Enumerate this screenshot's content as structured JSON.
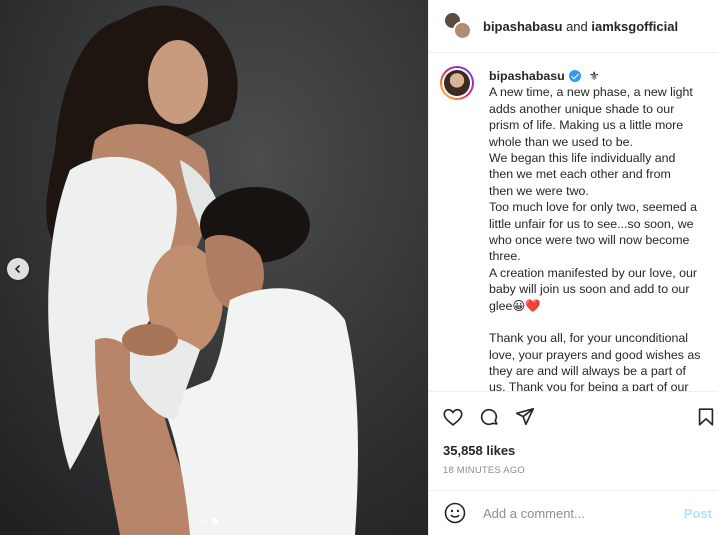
{
  "header": {
    "user1": "bipashabasu",
    "connector": " and ",
    "user2": "iamksgofficial"
  },
  "caption": {
    "username": "bipashabasu",
    "lines": [
      "A new time, a new phase, a new light",
      "adds another unique shade to our",
      "prism of life. Making us a little more",
      "whole than we used to be.",
      "We began this life individually and",
      "then we met each other and from",
      "then we were two.",
      "Too much love for only two, seemed a",
      "little unfair for us to see...so soon, we",
      "who once were two will now become",
      "three.",
      "A creation manifested by our love, our",
      "baby will join us soon and add to our",
      "glee😀❤️",
      "",
      "Thank you all, for your unconditional",
      "love, your prayers and good wishes as",
      "they are and will always be a part of",
      "us. Thank you for being a part of our"
    ]
  },
  "likes": "35,858 likes",
  "time": "18 MINUTES AGO",
  "comment": {
    "placeholder": "Add a comment...",
    "post_label": "Post"
  },
  "icons": {
    "like": "heart-icon",
    "comment": "comment-icon",
    "share": "send-icon",
    "save": "bookmark-icon",
    "emoji": "emoji-icon",
    "prev": "chevron-left-icon"
  },
  "colors": {
    "verified": "#3897f0",
    "post_button": "#b2dffc",
    "muted": "#8e8e8e"
  },
  "carousel": {
    "slide_count": 2,
    "active_index": 1
  }
}
